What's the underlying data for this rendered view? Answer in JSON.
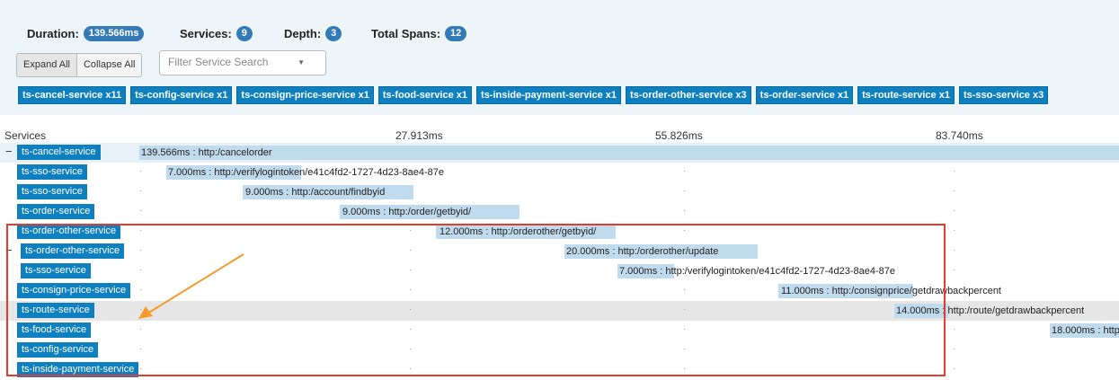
{
  "summary": {
    "duration_label": "Duration:",
    "duration_value": "139.566ms",
    "services_label": "Services:",
    "services_value": "9",
    "depth_label": "Depth:",
    "depth_value": "3",
    "spans_label": "Total Spans:",
    "spans_value": "12"
  },
  "controls": {
    "expand_all": "Expand All",
    "collapse_all": "Collapse All",
    "filter_placeholder": "Filter Service Search",
    "filter_caret": "▼"
  },
  "chips": [
    "ts-cancel-service x11",
    "ts-config-service x1",
    "ts-consign-price-service x1",
    "ts-food-service x1",
    "ts-inside-payment-service x1",
    "ts-order-other-service x3",
    "ts-order-service x1",
    "ts-route-service x1",
    "ts-sso-service x3"
  ],
  "timeline": {
    "services_header": "Services",
    "ticks": [
      "27.913ms",
      "55.826ms",
      "83.740ms"
    ],
    "rows": [
      {
        "service": "ts-cancel-service",
        "expander": "−",
        "label": "139.566ms : http:/cancelorder"
      },
      {
        "service": "ts-sso-service",
        "expander": "",
        "label": "7.000ms : http:/verifylogintoken/e41c4fd2-1727-4d23-8ae4-87e"
      },
      {
        "service": "ts-sso-service",
        "expander": "",
        "label": "9.000ms : http:/account/findbyid"
      },
      {
        "service": "ts-order-service",
        "expander": "",
        "label": "9.000ms : http:/order/getbyid/"
      },
      {
        "service": "ts-order-other-service",
        "expander": "",
        "label": "12.000ms : http:/orderother/getbyid/"
      },
      {
        "service": "ts-order-other-service",
        "expander": "−",
        "label": "20.000ms : http:/orderother/update"
      },
      {
        "service": "ts-sso-service",
        "expander": "",
        "label": "7.000ms : http:/verifylogintoken/e41c4fd2-1727-4d23-8ae4-87e"
      },
      {
        "service": "ts-consign-price-service",
        "expander": "",
        "label": "11.000ms : http:/consignprice/getdrawbackpercent"
      },
      {
        "service": "ts-route-service",
        "expander": "",
        "label": "14.000ms : http:/route/getdrawbackpercent"
      },
      {
        "service": "ts-food-service",
        "expander": "",
        "label": "18.000ms : http:"
      },
      {
        "service": "ts-config-service",
        "expander": "",
        "label": ""
      },
      {
        "service": "ts-inside-payment-service",
        "expander": "",
        "label": ""
      }
    ]
  },
  "colors": {
    "accent": "#0e7fbf",
    "pill": "#337ab7",
    "highlight_box": "#e53b2c",
    "arrow": "#f39a2b"
  }
}
